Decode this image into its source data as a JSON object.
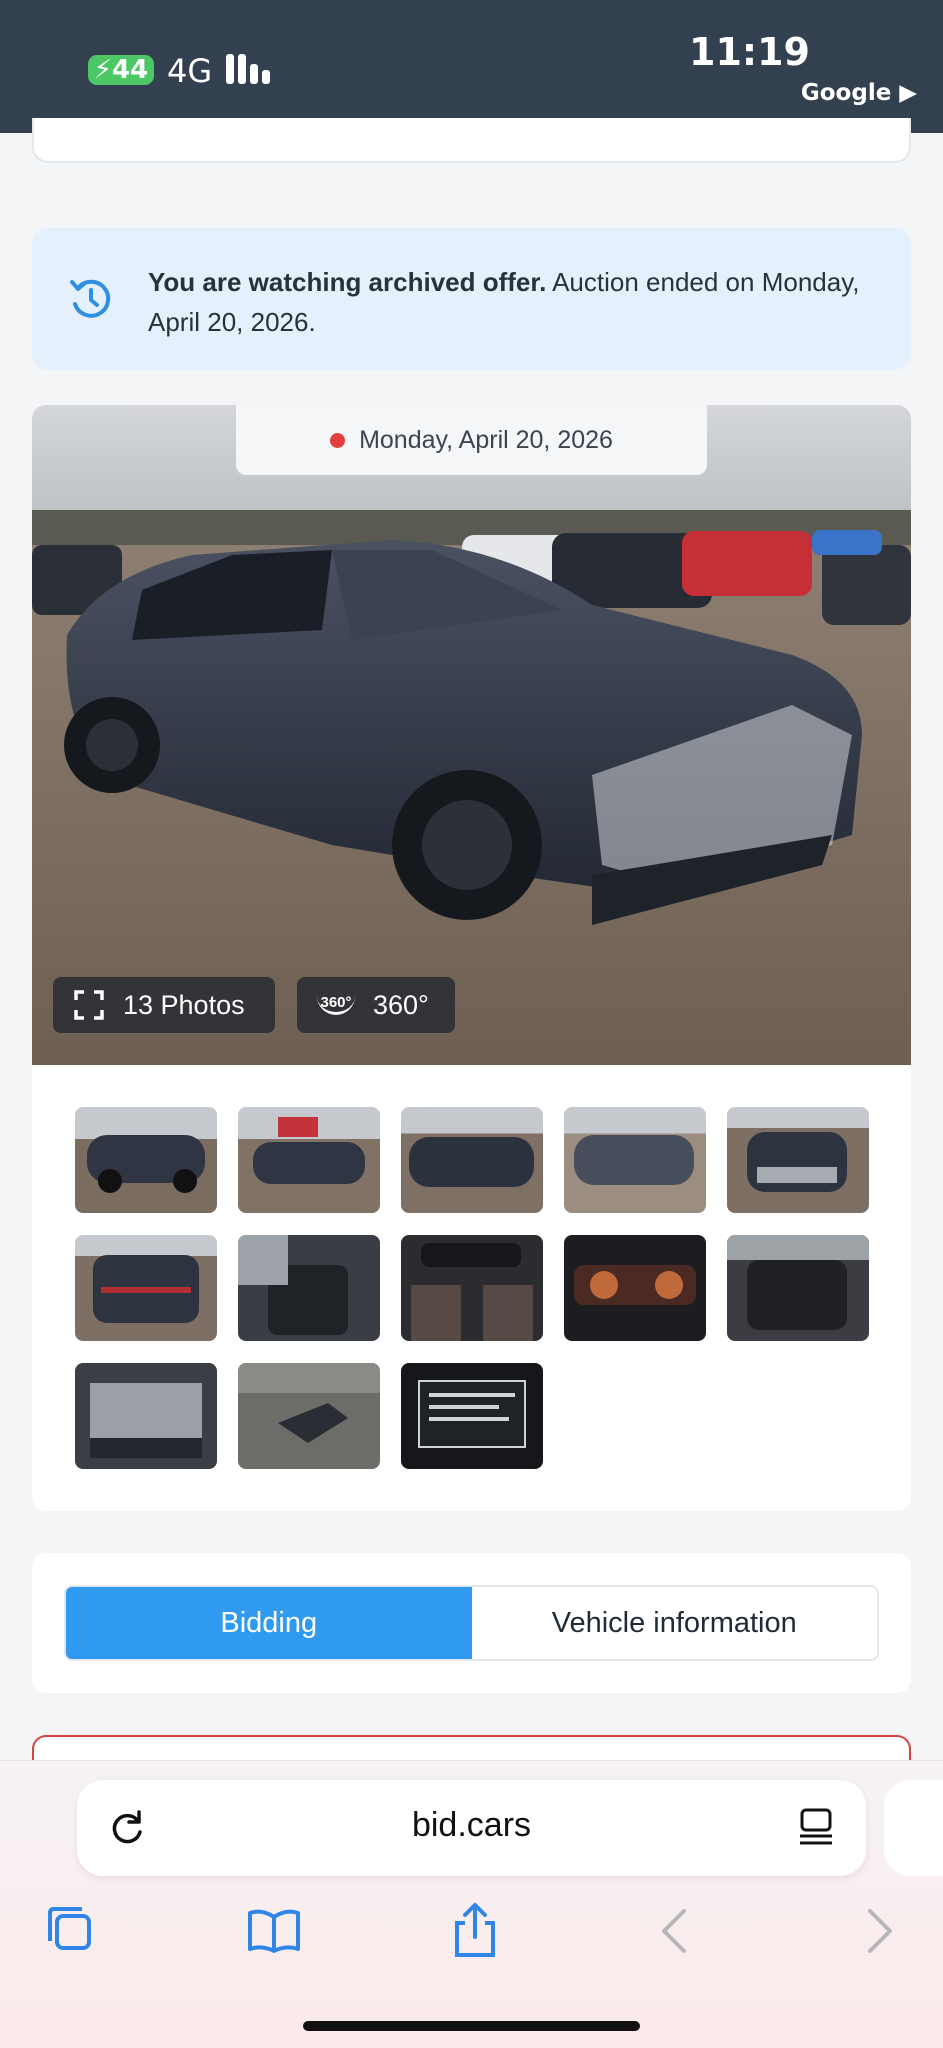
{
  "status_bar": {
    "battery": "44",
    "network": "4G",
    "time": "11:19",
    "back_app": "Google ▶"
  },
  "notice": {
    "bold": "You are watching archived offer.",
    "text": " Auction ended on Monday, April 20, 2026.",
    "icon": "history-icon"
  },
  "photo": {
    "date": "Monday, April 20, 2026",
    "photos_label": "13 Photos",
    "view360_label": "360°",
    "view360_badge": "360°",
    "thumbnail_count": 13
  },
  "tabs": {
    "bidding": "Bidding",
    "vehicle_info": "Vehicle information"
  },
  "browser": {
    "url": "bid.cars"
  },
  "colors": {
    "status_bar": "#334050",
    "accent": "#2f9af0",
    "notice_bg": "#e4f1fc",
    "danger": "#d0453f"
  }
}
